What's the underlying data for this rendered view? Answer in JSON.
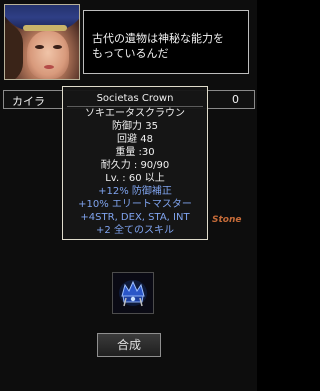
{
  "dialog": {
    "lines": [
      "古代の遺物は神秘な能力を",
      "もっているんだ"
    ]
  },
  "character": {
    "name": "カイラ",
    "value": "0"
  },
  "background": {
    "stone_label": "Stone"
  },
  "tooltip": {
    "name_en": "Societas Crown",
    "name_jp": "ソキエータスクラウン",
    "defense": "防御力 35",
    "evasion": "回避 48",
    "weight": "重量 :30",
    "durability": "耐久力 : 90/90",
    "level": "Lv. : 60 以上",
    "bonus_1": "+12% 防御補正",
    "bonus_2": "+10% エリートマスター",
    "bonus_3": "+4STR, DEX, STA, INT",
    "bonus_4": "+2 全てのスキル"
  },
  "slot": {
    "item_icon": "crown-icon"
  },
  "buttons": {
    "compose_label": "合成"
  },
  "colors": {
    "tooltip_white": "#f0f0f0",
    "tooltip_blue": "#7fa3ee",
    "border": "#e0dccc"
  }
}
